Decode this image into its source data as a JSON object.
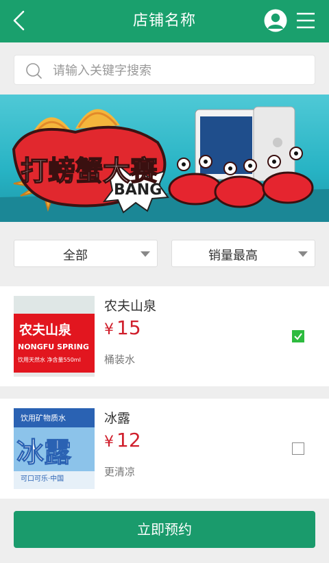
{
  "header": {
    "title": "店铺名称",
    "back_icon": "chevron-left-icon",
    "avatar_icon": "user-avatar-icon",
    "menu_icon": "hamburger-menu-icon",
    "bg_color": "#1aa06d"
  },
  "search": {
    "placeholder": "请输入关键字搜索",
    "icon": "search-icon"
  },
  "banner": {
    "title_text": "打螃蟹大赛",
    "bang_text": "BANG"
  },
  "filters": {
    "category": "全部",
    "sort": "销量最高"
  },
  "products": [
    {
      "name": "农夫山泉",
      "currency": "¥",
      "price": "15",
      "tag": "桶装水",
      "checked": true,
      "label_lines": [
        "农夫山泉",
        "NONGFU SPRING",
        "饮用天然水 净含量550ml"
      ]
    },
    {
      "name": "冰露",
      "currency": "¥",
      "price": "12",
      "tag": "更清凉",
      "checked": false,
      "label_lines": [
        "饮用矿物质水",
        "冰露",
        "可口可乐·中国"
      ]
    }
  ],
  "footer": {
    "book_label": "立即预约"
  },
  "colors": {
    "accent": "#1aa06d",
    "price": "#d01f2c",
    "check": "#2dbb3f"
  }
}
